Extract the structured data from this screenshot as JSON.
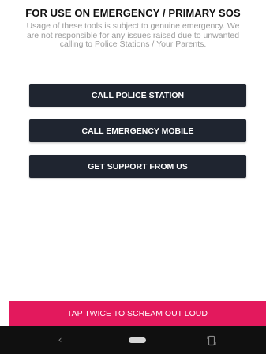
{
  "header": {
    "title": "FOR USE ON EMERGENCY / PRIMARY SOS",
    "disclaimer": "Usage of these tools is subject to genuine emergency. We are not responsible for any issues raised due to unwanted calling to Police Stations / Your Parents."
  },
  "actions": {
    "call_police_label": "CALL POLICE STATION",
    "call_mobile_label": "CALL EMERGENCY MOBILE",
    "support_label": "GET SUPPORT FROM US"
  },
  "scream": {
    "label": "TAP TWICE TO SCREAM OUT LOUD"
  },
  "nav": {
    "back_icon": "‹"
  },
  "colors": {
    "button_dark": "#1f2530",
    "accent_pink": "#e3195d",
    "nav_bar": "#101010"
  },
  "icons": {
    "back": "chevron-left-icon",
    "home": "home-pill-icon",
    "rotate": "rotate-icon"
  }
}
